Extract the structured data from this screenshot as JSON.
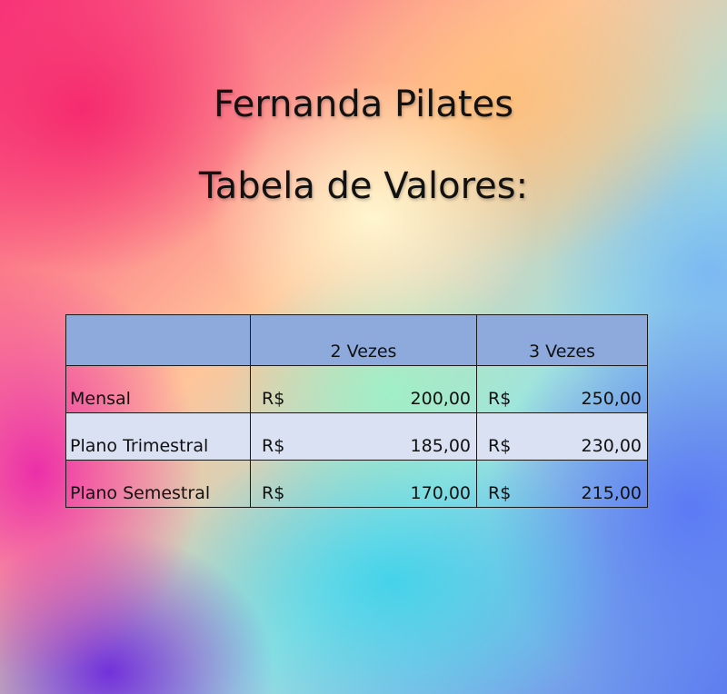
{
  "heading": {
    "line1": "Fernanda Pilates",
    "line2": "Tabela de Valores:"
  },
  "table": {
    "headers": [
      "",
      "2 Vezes",
      "3 Vezes"
    ],
    "currency": "R$",
    "rows": [
      {
        "label": "Mensal",
        "values": [
          "200,00",
          "250,00"
        ]
      },
      {
        "label": "Plano Trimestral",
        "values": [
          "185,00",
          "230,00"
        ]
      },
      {
        "label": "Plano Semestral",
        "values": [
          "170,00",
          "215,00"
        ]
      }
    ]
  },
  "colors": {
    "header_fill": "#8ea9db",
    "alt_row_fill": "#d9e1f2"
  }
}
